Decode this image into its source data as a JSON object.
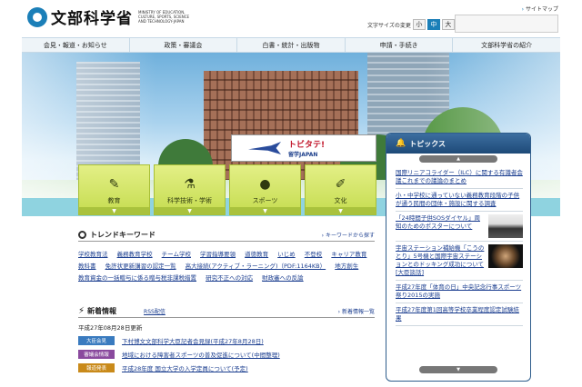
{
  "header": {
    "logo_text": "文部科学省",
    "logo_sub": "MINISTRY OF EDUCATION, CULTURE, SPORTS, SCIENCE AND TECHNOLOGY-JAPAN",
    "sitemap": "サイトマップ",
    "font_size_label": "文字サイズの変更",
    "font_sizes": [
      "小",
      "中",
      "大"
    ]
  },
  "gnav": [
    "会見・報道・お知らせ",
    "政策・審議会",
    "白書・統計・出版物",
    "申請・手続き",
    "文部科学省の紹介"
  ],
  "banner": {
    "main": "トビタテ!",
    "sub": "留学JAPAN"
  },
  "categories": [
    {
      "label": "教育",
      "icon": "pencil-icon"
    },
    {
      "label": "科学技術・学術",
      "icon": "flask-icon"
    },
    {
      "label": "スポーツ",
      "icon": "runner-icon"
    },
    {
      "label": "文化",
      "icon": "brush-icon"
    }
  ],
  "topics": {
    "title": "トピックス",
    "items": [
      {
        "text": "国際リニアコライダー（ILC）に関する有識者会議これまでの議論のまとめ"
      },
      {
        "text": "小・中学校に通っていない義務教育段階の子供が通う民間の団体・施設に関する調査"
      },
      {
        "text": "「24時間子供SOSダイヤル」周知のためのポスターについて",
        "thumb": "girl"
      },
      {
        "text": "宇宙ステーション補給機「こうのとり」5号機と国際宇宙ステーションとのドッキング成功について[大臣談話]",
        "thumb": "space"
      },
      {
        "text": "平成27年度「体育の日」中央記念行事スポーツ祭り2015の実施"
      },
      {
        "text": "平成27年度第1回高等学校卒業程度認定試験結果"
      }
    ]
  },
  "trend": {
    "title": "トレンドキーワード",
    "more": "キーワードから探す",
    "keywords": [
      "学校教育法",
      "義務教育学校",
      "チーム学校",
      "学習指導要領",
      "道徳教育",
      "いじめ",
      "不登校",
      "キャリア教育",
      "教科書",
      "免許状更新講習の認定一覧",
      "高大接続(アクティブ・ラーニング)（PDF:1164KB）",
      "地方創生",
      "教育資金の一括贈与に係る贈与税非課税措置",
      "研究不正への対応",
      "財政審への反論"
    ]
  },
  "news": {
    "title": "新着情報",
    "rss": "RSS配信",
    "more": "新着情報一覧",
    "date": "平成27年08月28日更新",
    "items": [
      {
        "badge": "大臣会見",
        "color": "#3a7bbf",
        "text": "下村博文文部科学大臣記者会見録(平成27年8月28日)"
      },
      {
        "badge": "審議会情報",
        "color": "#8a4a9e",
        "text": "地域における障害者スポーツの普及促進について(中間整理)"
      },
      {
        "badge": "報道発表",
        "color": "#c98a1a",
        "text": "平成28年度 国立大学の入学定員について(予定)"
      }
    ]
  }
}
